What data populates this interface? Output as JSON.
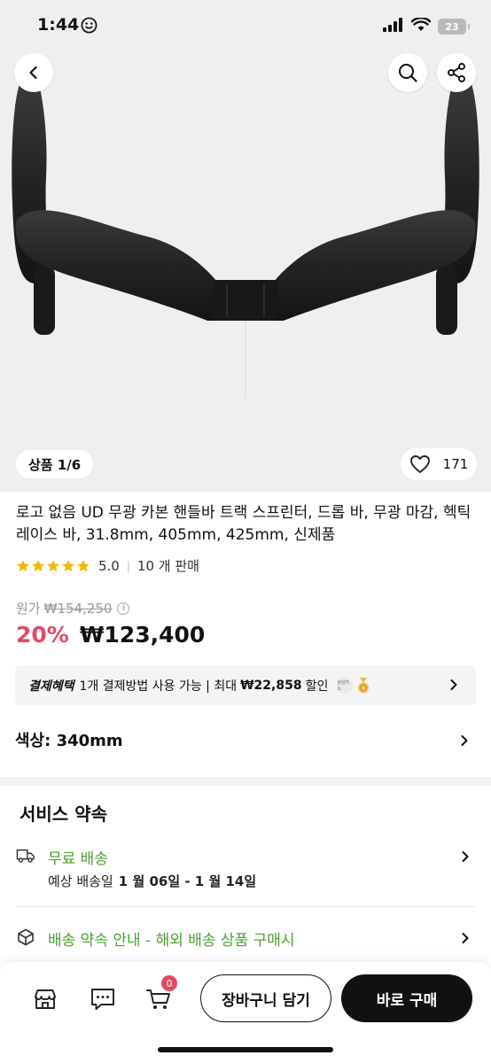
{
  "status_bar": {
    "time": "1:44",
    "battery": "23"
  },
  "gallery": {
    "counter": "상품 1/6",
    "like_count": "171"
  },
  "product": {
    "title": "로고 없음 UD 무광 카본 핸들바 트랙 스프린터, 드롭 바, 무광 마감, 헥틱 레이스 바, 31.8mm, 405mm, 425mm, 신제품",
    "rating": "5.0",
    "sales": "10 개 판매",
    "original_label": "원가",
    "original_price": "₩154,250",
    "discount": "20%",
    "price": "₩123,400"
  },
  "benefit": {
    "label": "결제혜택",
    "text_before": "1개 결제방법 사용 가능 | 최대",
    "amount": "₩22,858",
    "text_after": "할인",
    "card_badge": "삼성카드"
  },
  "option": {
    "label": "색상: 340mm"
  },
  "service": {
    "title": "서비스 약속",
    "shipping_label": "무료 배송",
    "shipping_date_label": "예상 배송일",
    "shipping_date": "1 월 06일 - 1 월 14일",
    "promise_label": "배송 약속 안내 - 해외 배송 상품 구매시"
  },
  "bottom_bar": {
    "cart_count": "0",
    "add_to_cart": "장바구니 담기",
    "buy_now": "바로 구매"
  },
  "colors": {
    "discount": "#e2495f",
    "service_green": "#4aa031",
    "star": "#f5b800"
  },
  "icons": [
    "chevron-left-icon",
    "search-icon",
    "share-icon",
    "heart-icon",
    "star-icon",
    "info-icon",
    "chevron-right-icon",
    "truck-icon",
    "box-icon",
    "store-icon",
    "chat-icon",
    "cart-icon"
  ]
}
